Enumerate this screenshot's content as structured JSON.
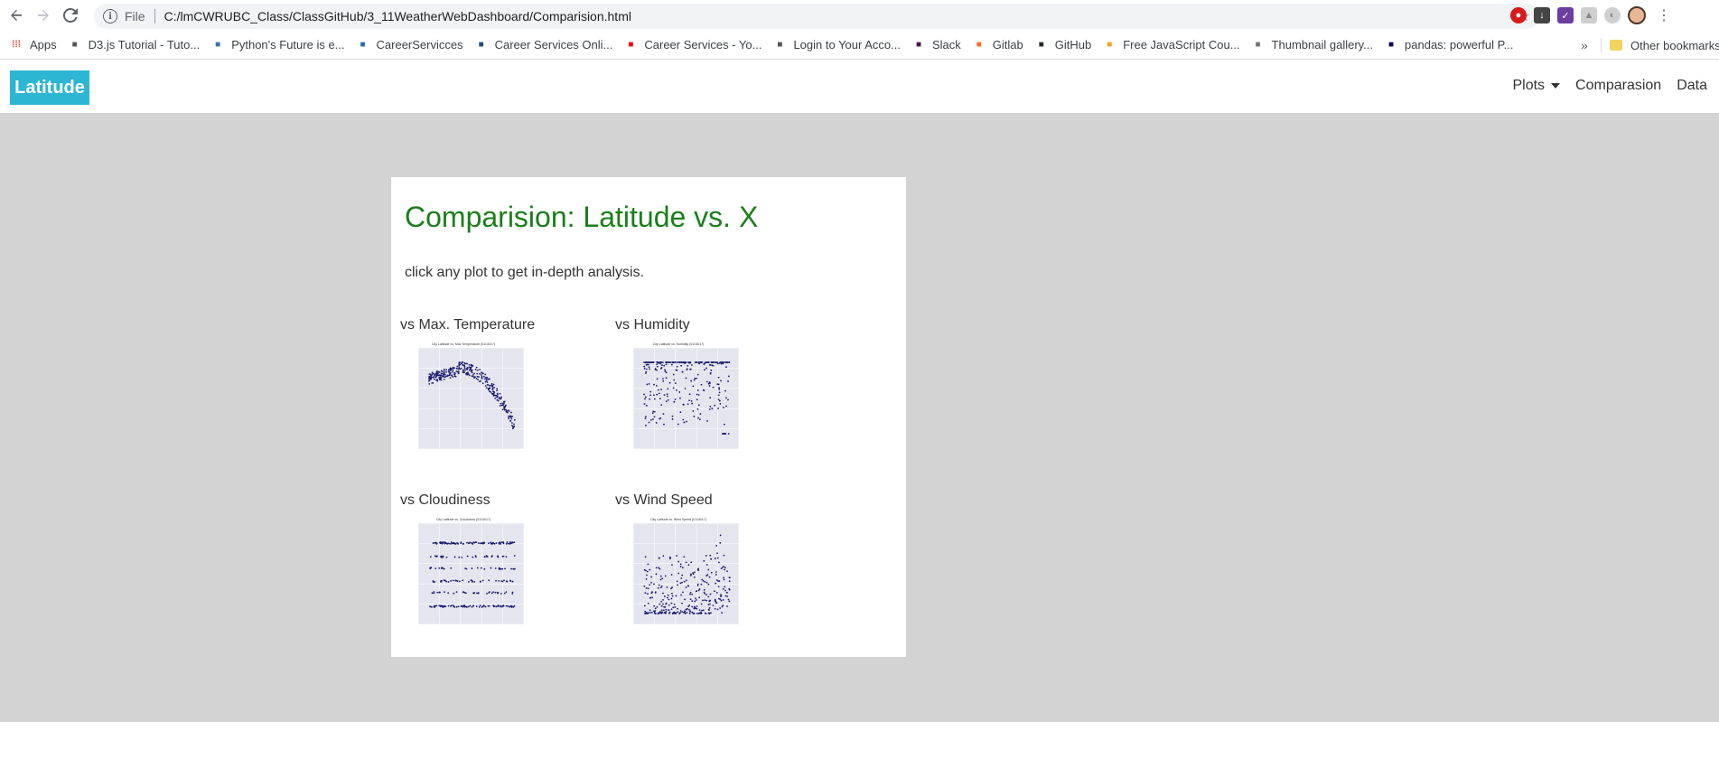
{
  "browser": {
    "file_label": "File",
    "url": "C:/lmCWRUBC_Class/ClassGitHub/3_11WeatherWebDashboard/Comparision.html",
    "bookmarks": [
      {
        "label": "Apps",
        "icon": "apps-grid-icon",
        "color": "#ea4335"
      },
      {
        "label": "D3.js Tutorial - Tuto...",
        "icon": "d3-icon",
        "color": "#555555"
      },
      {
        "label": "Python's Future is e...",
        "icon": "python-icon",
        "color": "#3776ab"
      },
      {
        "label": "CareerServicces",
        "icon": "career-icon",
        "color": "#2a6fb0"
      },
      {
        "label": "Career Services Onli...",
        "icon": "cs-icon",
        "color": "#1f4e79"
      },
      {
        "label": "Career Services - Yo...",
        "icon": "youtube-icon",
        "color": "#ff0000"
      },
      {
        "label": "Login to Your Acco...",
        "icon": "globe-icon",
        "color": "#555555"
      },
      {
        "label": "Slack",
        "icon": "slack-icon",
        "color": "#4a154b"
      },
      {
        "label": "Gitlab",
        "icon": "gitlab-icon",
        "color": "#fc6d26"
      },
      {
        "label": "GitHub",
        "icon": "github-icon",
        "color": "#24292e"
      },
      {
        "label": "Free JavaScript Cou...",
        "icon": "js-icon",
        "color": "#f7a21b"
      },
      {
        "label": "Thumbnail gallery...",
        "icon": "gallery-icon",
        "color": "#777777"
      },
      {
        "label": "pandas: powerful P...",
        "icon": "pandas-icon",
        "color": "#150458"
      }
    ],
    "more_label": "»",
    "other_bookmarks": "Other bookmarks"
  },
  "site": {
    "brand": "Latitude",
    "nav": {
      "plots": "Plots",
      "comparison": "Comparasion",
      "data": "Data"
    }
  },
  "card": {
    "title": "Comparision: Latitude vs. X",
    "subtitle": "click any plot to get in-depth analysis.",
    "plots": [
      {
        "label": "vs Max. Temperature",
        "thumb_title": "City Latitude vs. Max Temperature (01/16/17)",
        "kind": "temp"
      },
      {
        "label": "vs Humidity",
        "thumb_title": "City Latitude vs. Humidity (01/16/17)",
        "kind": "humidity"
      },
      {
        "label": "vs Cloudiness",
        "thumb_title": "City Latitude vs. Cloudiness (01/16/17)",
        "kind": "cloud"
      },
      {
        "label": "vs Wind Speed",
        "thumb_title": "City Latitude vs. Wind Speed (01/16/17)",
        "kind": "wind"
      }
    ]
  },
  "colors": {
    "brand": "#2cb6d3",
    "title_green": "#1a7f1a",
    "background_gray": "#d3d3d3",
    "point_navy": "#1a1a6e",
    "plot_bg": "#e5e5f0"
  }
}
